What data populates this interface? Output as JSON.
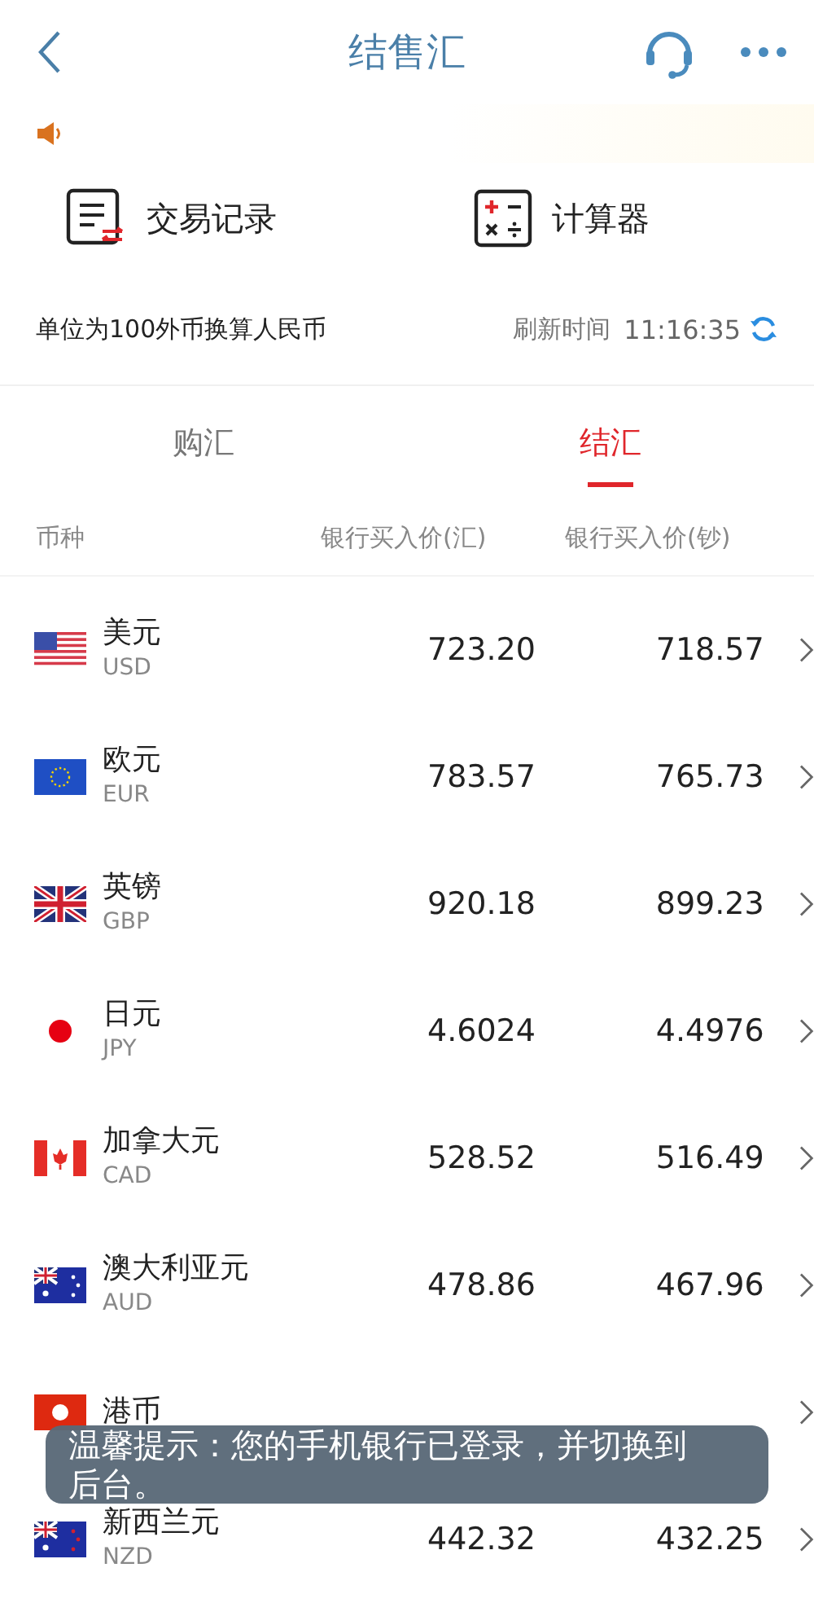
{
  "header": {
    "title": "结售汇"
  },
  "tools": [
    {
      "kind": "records",
      "label": "交易记录"
    },
    {
      "kind": "calculator",
      "label": "计算器"
    }
  ],
  "info": {
    "unit_note": "单位为100外币换算人民币",
    "refresh_label": "刷新时间",
    "refresh_time": "11:16:35"
  },
  "tabs": [
    {
      "label": "购汇",
      "selected": false
    },
    {
      "label": "结汇",
      "selected": true
    }
  ],
  "columns": [
    "币种",
    "银行买入价(汇)",
    "银行买入价(钞)"
  ],
  "rows": [
    {
      "kind": "us",
      "name": "美元",
      "code": "USD",
      "rate_transfer": "723.20",
      "rate_cash": "718.57"
    },
    {
      "kind": "eu",
      "name": "欧元",
      "code": "EUR",
      "rate_transfer": "783.57",
      "rate_cash": "765.73"
    },
    {
      "kind": "gb",
      "name": "英镑",
      "code": "GBP",
      "rate_transfer": "920.18",
      "rate_cash": "899.23"
    },
    {
      "kind": "jp",
      "name": "日元",
      "code": "JPY",
      "rate_transfer": "4.6024",
      "rate_cash": "4.4976"
    },
    {
      "kind": "ca",
      "name": "加拿大元",
      "code": "CAD",
      "rate_transfer": "528.52",
      "rate_cash": "516.49"
    },
    {
      "kind": "au",
      "name": "澳大利亚元",
      "code": "AUD",
      "rate_transfer": "478.86",
      "rate_cash": "467.96"
    },
    {
      "kind": "hk",
      "name": "港币"
    },
    {
      "kind": "nz",
      "name": "新西兰元",
      "code": "NZD",
      "rate_transfer": "442.32",
      "rate_cash": "432.25"
    }
  ],
  "toast": {
    "text": "温馨提示：您的手机银行已登录，并切换到后台。"
  }
}
